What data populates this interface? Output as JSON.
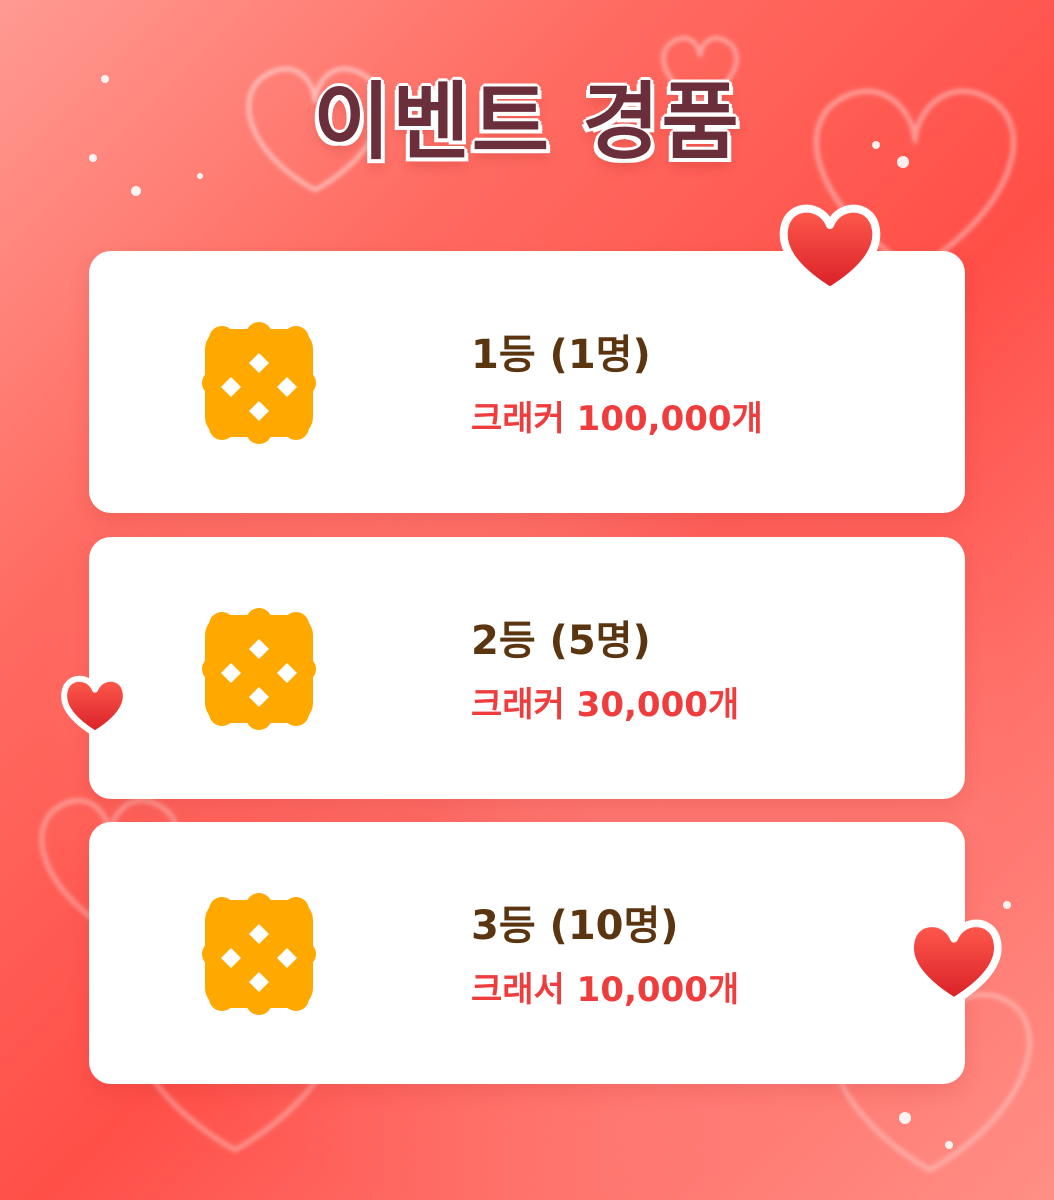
{
  "title": "이벤트 경품",
  "prizes": [
    {
      "rank": "1등 (1명)",
      "item": "크래커 100,000개",
      "icon": "cracker-icon"
    },
    {
      "rank": "2등 (5명)",
      "item": "크래커 30,000개",
      "icon": "cracker-icon"
    },
    {
      "rank": "3등 (10명)",
      "item": "크래서 10,000개",
      "icon": "cracker-icon"
    }
  ],
  "colors": {
    "background": "#ff5b52",
    "title_text": "#6a2f3b",
    "card_background": "#ffffff",
    "rank_text": "#5a3510",
    "prize_text": "#ef3d3d",
    "cracker": "#ffa800",
    "heart": "#e53935"
  }
}
